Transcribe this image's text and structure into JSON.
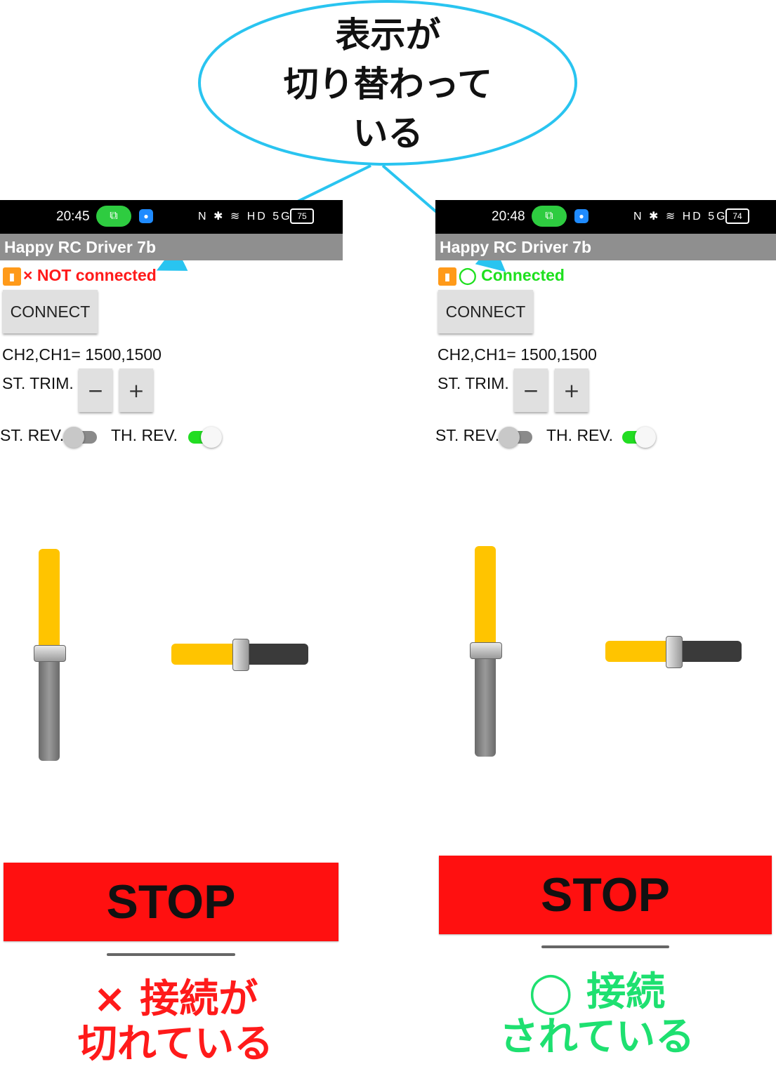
{
  "callout": {
    "line1": "表示が",
    "line2": "切り替わって",
    "line3": "いる"
  },
  "colors": {
    "bubble_stroke": "#29c4f0",
    "not_connected": "#ff1a1a",
    "connected": "#1ee01e",
    "slider_fill": "#ffc400",
    "stop_bg": "#ff1010",
    "toggle_on": "#22dd22"
  },
  "left_phone": {
    "status": {
      "time": "20:45",
      "battery": "75",
      "icons": "N ✱ ≋ HD 5G"
    },
    "app_title": "Happy RC Driver 7b",
    "connection_icon": "×",
    "connection_text": "NOT connected",
    "connect_label": "CONNECT",
    "channels_text": "CH2,CH1= 1500,1500",
    "trim_label": "ST. TRIM.",
    "minus_label": "−",
    "plus_label": "+",
    "st_rev_label": "ST. REV.",
    "th_rev_label": "TH. REV.",
    "st_rev_on": false,
    "th_rev_on": true,
    "throttle_level": 0.5,
    "steering_level": 0.5,
    "stop_label": "STOP"
  },
  "right_phone": {
    "status": {
      "time": "20:48",
      "battery": "74",
      "icons": "N ✱ ≋ HD 5G"
    },
    "app_title": "Happy RC Driver 7b",
    "connection_icon": "◯",
    "connection_text": "Connected",
    "connect_label": "CONNECT",
    "channels_text": "CH2,CH1= 1500,1500",
    "trim_label": "ST. TRIM.",
    "minus_label": "−",
    "plus_label": "+",
    "st_rev_label": "ST. REV.",
    "th_rev_label": "TH. REV.",
    "st_rev_on": false,
    "th_rev_on": true,
    "throttle_level": 0.5,
    "steering_level": 0.5,
    "stop_label": "STOP"
  },
  "captions": {
    "left_line1": "× 接続が",
    "left_line2": "切れている",
    "right_line1": "◯ 接続",
    "right_line2": "されている"
  }
}
